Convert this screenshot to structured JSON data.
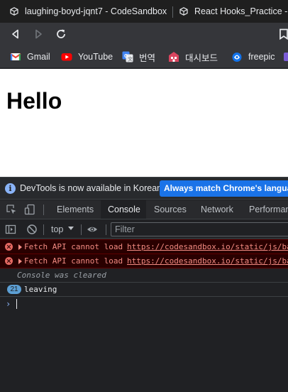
{
  "browser": {
    "tabs": [
      {
        "title": "laughing-boyd-jqnt7 - CodeSandbox"
      },
      {
        "title": "React Hooks_Practice - C"
      }
    ],
    "bookmarks": [
      {
        "label": "Gmail",
        "icon": "gmail-icon"
      },
      {
        "label": "YouTube",
        "icon": "youtube-icon"
      },
      {
        "label": "번역",
        "icon": "google-translate-icon"
      },
      {
        "label": "대시보드",
        "icon": "dashboard-icon"
      },
      {
        "label": "freepic",
        "icon": "freepik-icon"
      }
    ]
  },
  "page": {
    "heading": "Hello"
  },
  "devtools": {
    "infobar": {
      "message": "DevTools is now available in Korean!",
      "button": "Always match Chrome's language"
    },
    "tabs": [
      "Elements",
      "Console",
      "Sources",
      "Network",
      "Performan"
    ],
    "active_tab": "Console",
    "console_toolbar": {
      "context": "top",
      "filter_placeholder": "Filter"
    },
    "messages": [
      {
        "type": "error",
        "text": "Fetch API cannot load",
        "link": "https://codesandbox.io/static/js/ba"
      },
      {
        "type": "error",
        "text": "Fetch API cannot load",
        "link": "https://codesandbox.io/static/js/ba"
      },
      {
        "type": "info",
        "text": "Console was cleared"
      },
      {
        "type": "log",
        "count": "21",
        "text": "leaving"
      }
    ],
    "prompt_symbol": "›"
  },
  "colors": {
    "error_text": "#f28b82",
    "error_bg": "#290000",
    "accent_button": "#1a73e8",
    "badge": "#5c9fd4"
  }
}
